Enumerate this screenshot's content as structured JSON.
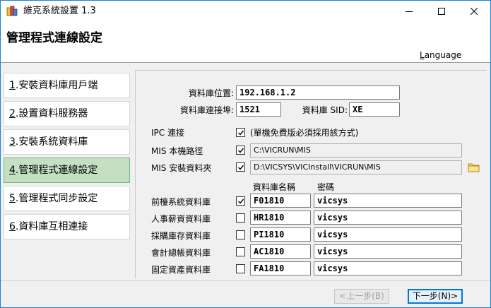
{
  "window": {
    "title": "維克系統設置 1.3",
    "icons": {
      "app": "app-icon",
      "minimize": "minimize-icon",
      "maximize": "maximize-icon",
      "close": "close-icon"
    }
  },
  "header": {
    "title": "管理程式連線設定",
    "language_accel": "L",
    "language_rest": "anguage"
  },
  "sidebar": {
    "items": [
      {
        "num": "1",
        "label": ".安裝資料庫用戶端",
        "active": false
      },
      {
        "num": "2",
        "label": ".設置資料服務器",
        "active": false
      },
      {
        "num": "3",
        "label": ".安裝系統資料庫",
        "active": false
      },
      {
        "num": "4",
        "label": ".管理程式連線設定",
        "active": true
      },
      {
        "num": "5",
        "label": ".管理程式同步設定",
        "active": false
      },
      {
        "num": "6",
        "label": ".資料庫互相連接",
        "active": false
      }
    ]
  },
  "db": {
    "location_label": "資料庫位置:",
    "location_value": "192.168.1.2",
    "port_label": "資料庫連接埠:",
    "port_value": "1521",
    "sid_label": "資料庫 SID:",
    "sid_value": "XE"
  },
  "ipc": {
    "label": "IPC 連接",
    "checked": true,
    "note": "(單機免費版必須採用該方式)"
  },
  "mis": {
    "local_path_label": "MIS 本機路徑",
    "local_path_checked": true,
    "local_path_value": "C:\\VICRUN\\MIS",
    "install_folder_label": "MIS 安裝資料夾",
    "install_folder_checked": true,
    "install_folder_value": "D:\\VICSYS\\VICInstall\\VICRUN\\MIS",
    "folder_icon": "folder-icon"
  },
  "schemas": {
    "col_name": "資料庫名稱",
    "col_password": "密碼",
    "rows": [
      {
        "label": "前檯系統資料庫",
        "checked": true,
        "name": "F01810",
        "password": "vicsys"
      },
      {
        "label": "人事薪資資料庫",
        "checked": false,
        "name": "HR1810",
        "password": "vicsys"
      },
      {
        "label": "採購庫存資料庫",
        "checked": false,
        "name": "PI1810",
        "password": "vicsys"
      },
      {
        "label": "會計總帳資料庫",
        "checked": false,
        "name": "AC1810",
        "password": "vicsys"
      },
      {
        "label": "固定資產資料庫",
        "checked": false,
        "name": "FA1810",
        "password": "vicsys"
      }
    ]
  },
  "footer": {
    "prev_label": "<上一步(B)",
    "next_label": "下一步(N)>"
  },
  "colors": {
    "accent": "#0078d7",
    "active_nav": "#c3e0c3",
    "window_border": "#1883d7"
  }
}
